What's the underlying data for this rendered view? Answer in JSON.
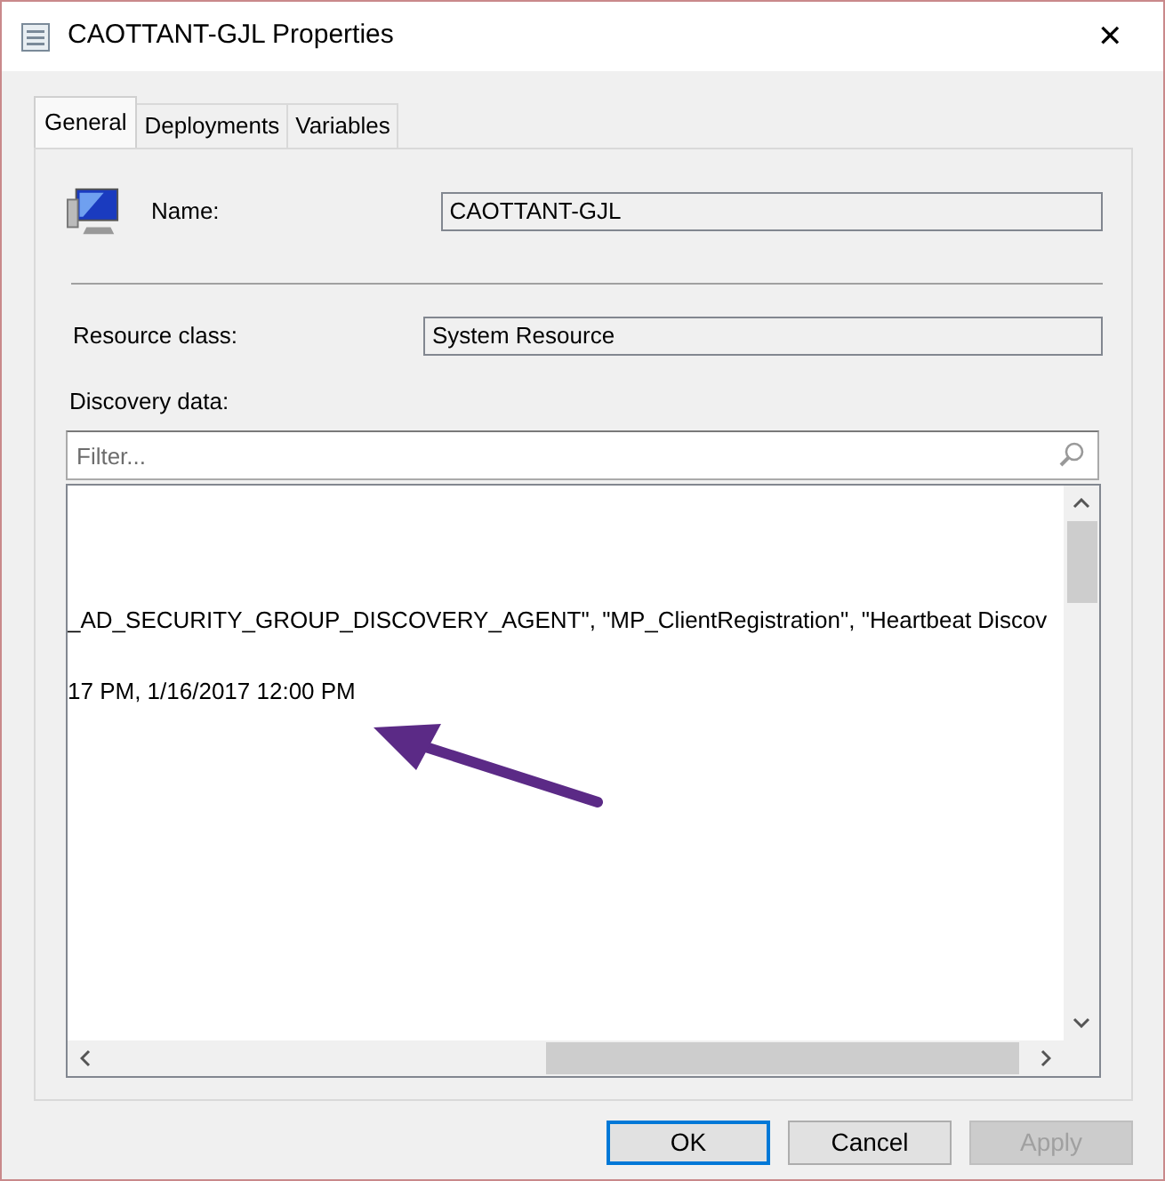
{
  "window": {
    "title": "CAOTTANT-GJL Properties",
    "close": "✕"
  },
  "tabs": [
    {
      "label": "General",
      "selected": true
    },
    {
      "label": "Deployments",
      "selected": false
    },
    {
      "label": "Variables",
      "selected": false
    }
  ],
  "fields": [
    {
      "label": "Name:",
      "value": "CAOTTANT-GJL"
    },
    {
      "label": "Resource class:",
      "value": "System Resource"
    }
  ],
  "discovery": {
    "label": "Discovery data:",
    "filter": {
      "placeholder": "Filter..."
    },
    "lines": [
      "_AD_SECURITY_GROUP_DISCOVERY_AGENT\", \"MP_ClientRegistration\", \"Heartbeat Discov",
      "17 PM, 1/16/2017 12:00 PM"
    ]
  },
  "buttons": [
    {
      "label": "OK",
      "default": true,
      "disabled": false
    },
    {
      "label": "Cancel",
      "default": false,
      "disabled": false
    },
    {
      "label": "Apply",
      "default": false,
      "disabled": true
    }
  ]
}
